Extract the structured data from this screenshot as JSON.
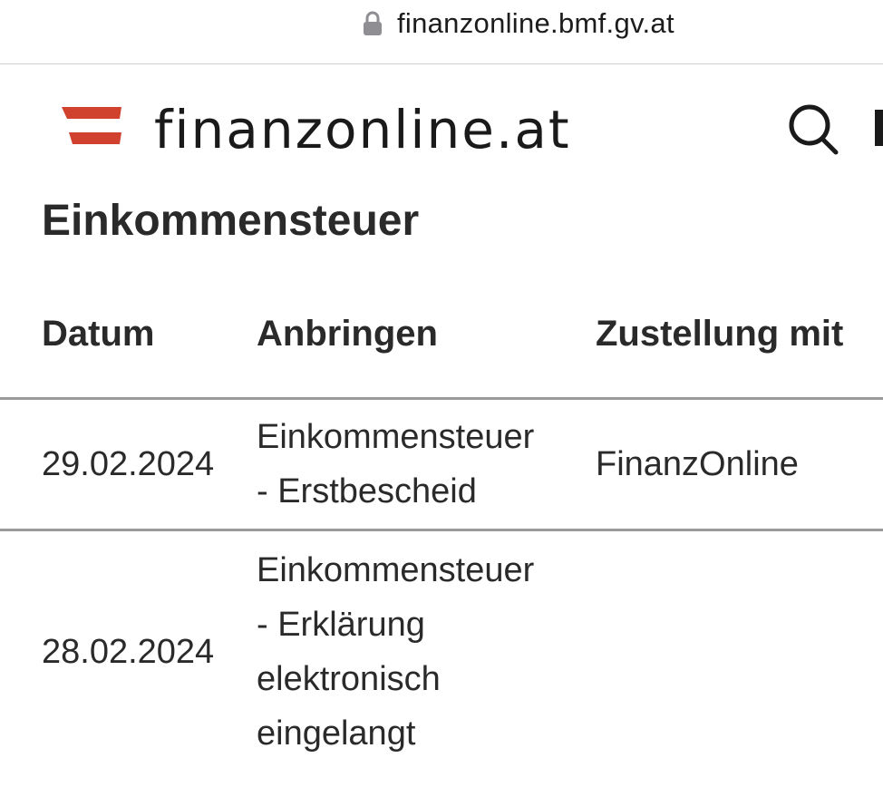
{
  "browser": {
    "url": "finanzonline.bmf.gv.at"
  },
  "header": {
    "brand": "finanzonline.at"
  },
  "page": {
    "title": "Einkommensteuer"
  },
  "table": {
    "columns": [
      "Datum",
      "Anbringen",
      "Zustellung mit"
    ],
    "rows": [
      {
        "datum": "29.02.2024",
        "anbringen_lines": [
          "Einkommensteuer",
          "- Erstbescheid"
        ],
        "zustellung": "FinanzOnline"
      },
      {
        "datum": "28.02.2024",
        "anbringen_lines": [
          "Einkommensteuer",
          "- Erklärung",
          "elektronisch",
          "eingelangt"
        ],
        "zustellung": ""
      }
    ]
  },
  "icons": {
    "lock": "lock-icon",
    "logo": "austria-flag-logo",
    "search": "search-icon",
    "menu": "menu-icon"
  },
  "colors": {
    "flag_red": "#d0412e",
    "divider": "#9a9a9a",
    "text": "#2a2a2a"
  }
}
